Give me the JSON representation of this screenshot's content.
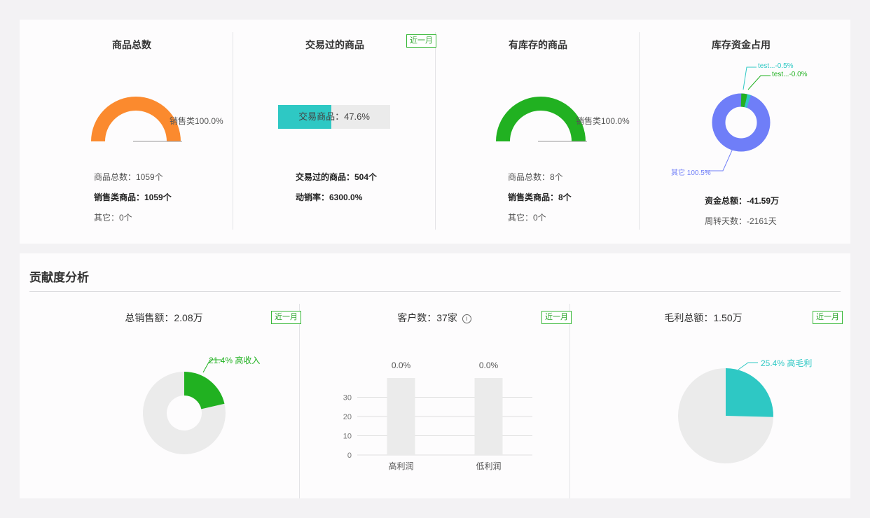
{
  "colors": {
    "orange": "#fb8a2e",
    "green": "#21b121",
    "teal": "#2ec8c4",
    "blue": "#6f7ef8",
    "gray": "#ebebeb",
    "badge": "#38b838"
  },
  "top": {
    "cards": [
      {
        "title": "商品总数",
        "gauge_label": "销售类100.0%",
        "gauge_percent": 100,
        "stats": [
          "商品总数：1059个",
          "销售类商品：1059个",
          "其它：0个"
        ]
      },
      {
        "title": "交易过的商品",
        "badge": "近一月",
        "progress_label": "交易商品：47.6%",
        "progress_percent": 47.6,
        "stats": [
          "交易过的商品：504个",
          "动销率：6300.0%"
        ]
      },
      {
        "title": "有库存的商品",
        "gauge_label": "销售类100.0%",
        "gauge_percent": 100,
        "stats": [
          "商品总数：8个",
          "销售类商品：8个",
          "其它：0个"
        ]
      },
      {
        "title": "库存资金占用",
        "donut_labels": [
          "test...-0.5%",
          "test...-0.0%",
          "其它 100.5%"
        ],
        "donut_slices": [
          0.5,
          0.3,
          100.5
        ],
        "stats": [
          "资金总额：-41.59万",
          "周转天数：-2161天"
        ]
      }
    ]
  },
  "contribution": {
    "section_title": "贡献度分析",
    "cards": [
      {
        "title": "总销售额：2.08万",
        "badge": "近一月",
        "slice_label": "21.4% 高收入",
        "percent": 21.4
      },
      {
        "title": "客户数：37家",
        "info_icon": "info-icon",
        "badge": "近一月",
        "bar_labels": [
          "0.0%",
          "0.0%"
        ],
        "categories": [
          "高利润",
          "低利润"
        ]
      },
      {
        "title": "毛利总额：1.50万",
        "badge": "近一月",
        "slice_label": "25.4% 高毛利",
        "percent": 25.4
      }
    ]
  },
  "chart_data": [
    {
      "type": "pie",
      "title": "总销售额：2.08万",
      "labels": [
        "高收入",
        ""
      ],
      "values": [
        21.4,
        78.6
      ]
    },
    {
      "type": "bar",
      "title": "客户数：37家",
      "categories": [
        "高利润",
        "低利润"
      ],
      "values": [
        0.0,
        0.0
      ],
      "data_labels": [
        "0.0%",
        "0.0%"
      ],
      "ylim": [
        0,
        40
      ],
      "yticks": [
        "0",
        "10",
        "20",
        "30"
      ],
      "grid": true
    },
    {
      "type": "pie",
      "title": "毛利总额：1.50万",
      "labels": [
        "高毛利",
        ""
      ],
      "values": [
        25.4,
        74.6
      ]
    }
  ]
}
